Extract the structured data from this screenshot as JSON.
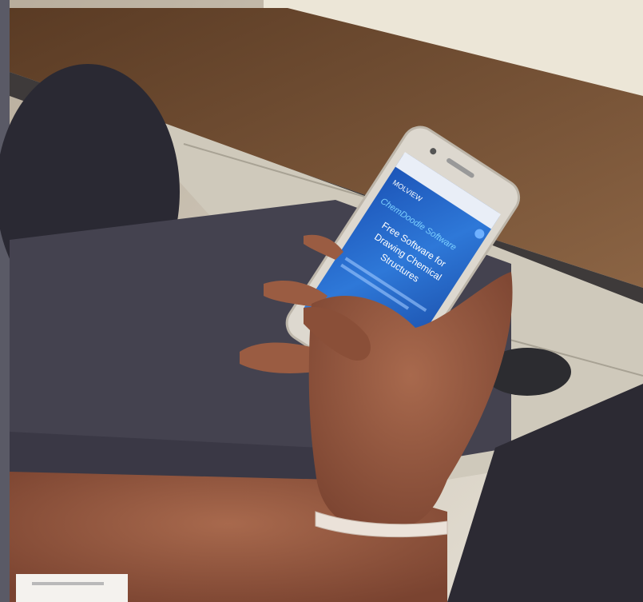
{
  "photo": {
    "subject": "hand-holding-smartphone",
    "colors": {
      "floor": "#c9c3b4",
      "bench_wood": "#6b4a30",
      "jeans": "#3e3c48",
      "skin": "#9b5f45",
      "phone_body": "#d9d4cc",
      "screen_blue": "#1f63c9",
      "bracelet": "#e9dfd6"
    }
  },
  "phone_screen": {
    "brand_text": "MOLVIEW",
    "headline_top": "ChemDoodle Software",
    "headline_lines": [
      "Free Software for",
      "Drawing Chemical",
      "Structures"
    ],
    "icons": [
      "logo-icon",
      "menu-icon",
      "refresh-icon",
      "more-icon"
    ]
  }
}
